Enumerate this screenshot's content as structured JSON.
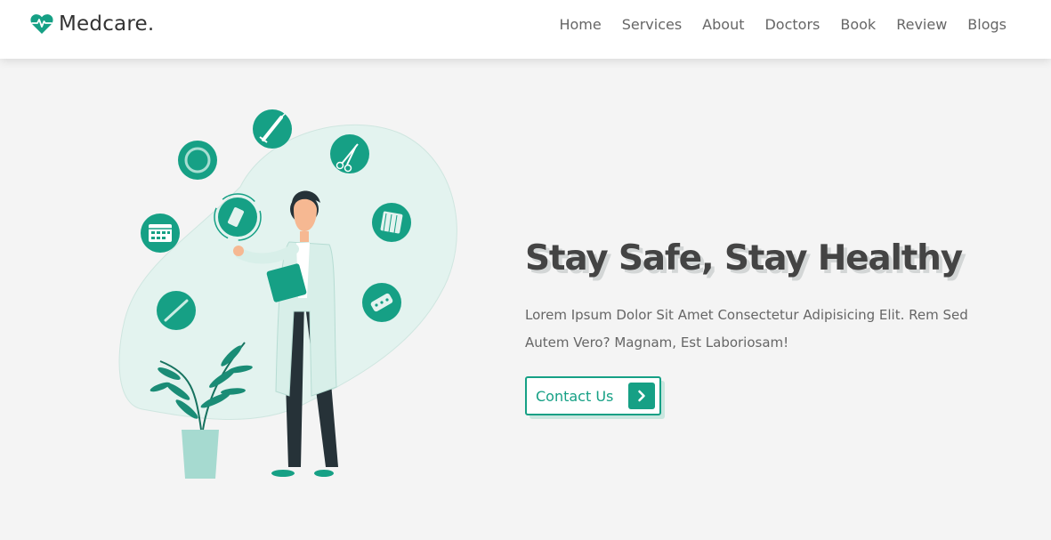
{
  "brand": {
    "name": "Medcare.",
    "icon": "heartbeat-icon",
    "accent": "#16a085"
  },
  "nav": {
    "items": [
      {
        "label": "Home"
      },
      {
        "label": "Services"
      },
      {
        "label": "About"
      },
      {
        "label": "Doctors"
      },
      {
        "label": "Book"
      },
      {
        "label": "Review"
      },
      {
        "label": "Blogs"
      }
    ]
  },
  "hero": {
    "headline": "Stay Safe, Stay Healthy",
    "description": "Lorem Ipsum Dolor Sit Amet Consectetur Adipisicing Elit. Rem Sed Autem Vero? Magnam, Est Laboriosam!",
    "cta_label": "Contact Us",
    "cta_icon": "chevron-right-icon",
    "illustration_icons": [
      "syringe-icon",
      "ring-icon",
      "scissors-icon",
      "calendar-icon",
      "medicine-bottle-icon",
      "pill-box-icon",
      "thermometer-icon",
      "pill-blister-icon"
    ]
  },
  "colors": {
    "accent": "#16a085",
    "accent_light": "#c9e6df",
    "background": "#f4f4f4",
    "heading": "#444444",
    "text": "#666666"
  }
}
